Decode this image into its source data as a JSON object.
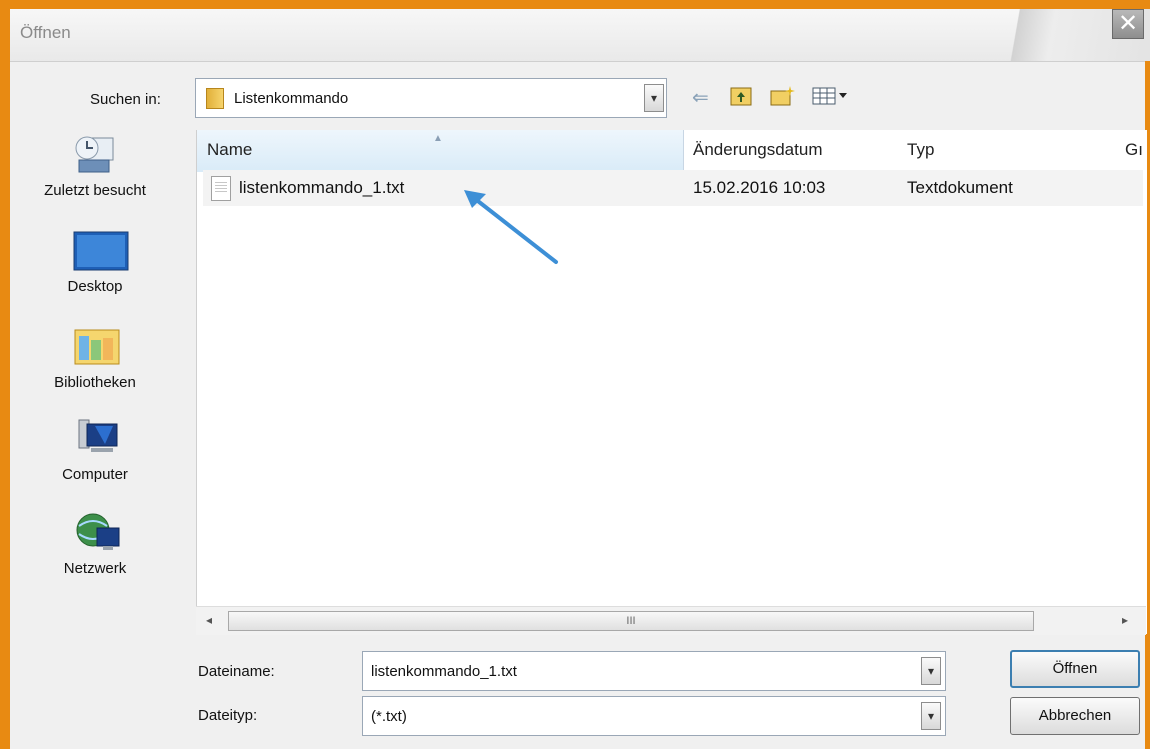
{
  "window": {
    "title": "Öffnen",
    "close_glyph": "✕"
  },
  "lookin": {
    "label": "Suchen in:",
    "value": "Listenkommando",
    "dropdown_glyph": "▾"
  },
  "toolbar": {
    "back_icon": "back-arrow-icon",
    "up_icon": "up-folder-icon",
    "new_folder_icon": "new-folder-icon",
    "views_icon": "view-menu-icon"
  },
  "places": [
    {
      "label": "Zuletzt besucht",
      "icon": "recent-places-icon"
    },
    {
      "label": "Desktop",
      "icon": "desktop-icon"
    },
    {
      "label": "Bibliotheken",
      "icon": "libraries-icon"
    },
    {
      "label": "Computer",
      "icon": "computer-icon"
    },
    {
      "label": "Netzwerk",
      "icon": "network-icon"
    }
  ],
  "columns": {
    "name": "Name",
    "modified": "Änderungsdatum",
    "type": "Typ",
    "size": "Gı"
  },
  "files": [
    {
      "name": "listenkommando_1.txt",
      "modified": "15.02.2016 10:03",
      "type": "Textdokument"
    }
  ],
  "scrollbar": {
    "thumb_grip": "III",
    "left_arrow": "◂",
    "right_arrow": "▸"
  },
  "filename": {
    "label": "Dateiname:",
    "value": "listenkommando_1.txt"
  },
  "filetype": {
    "label": "Dateityp:",
    "value": "(*.txt)"
  },
  "buttons": {
    "open": "Öffnen",
    "cancel": "Abbrechen"
  },
  "colors": {
    "frame": "#e88a12",
    "annotation_arrow": "#3d8fd6"
  }
}
